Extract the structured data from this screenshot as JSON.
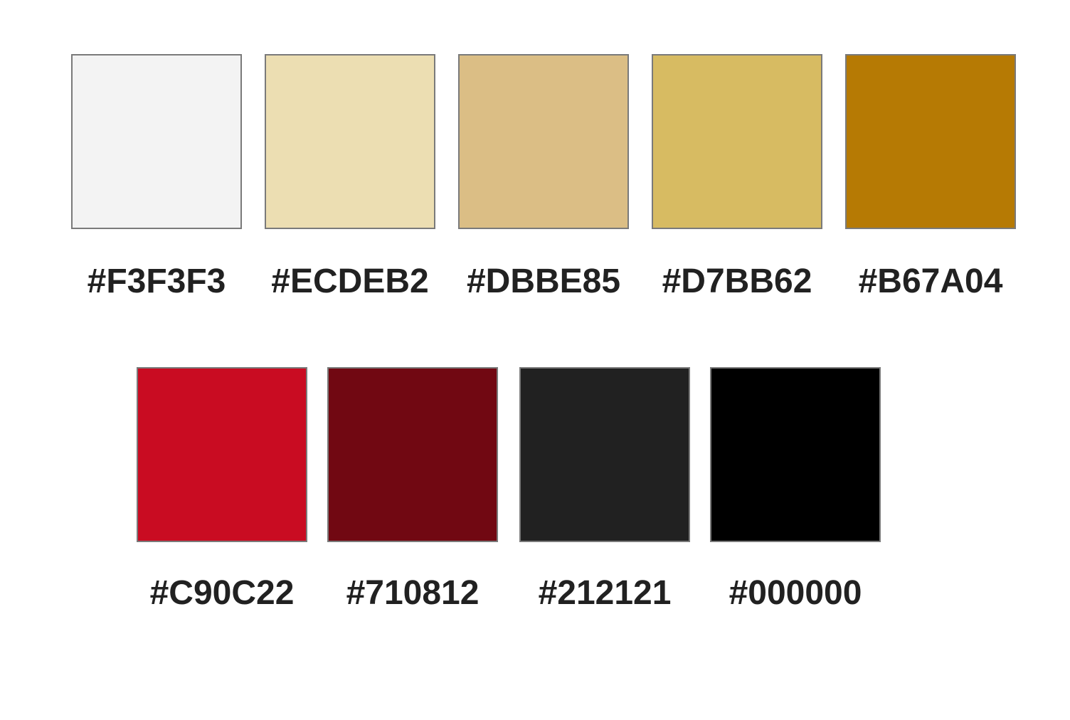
{
  "palette": {
    "swatches": [
      {
        "hex": "#F3F3F3",
        "color": "#F3F3F3"
      },
      {
        "hex": "#ECDEB2",
        "color": "#ECDEB2"
      },
      {
        "hex": "#DBBE85",
        "color": "#DBBE85"
      },
      {
        "hex": "#D7BB62",
        "color": "#D7BB62"
      },
      {
        "hex": "#B67A04",
        "color": "#B67A04"
      },
      {
        "hex": "#C90C22",
        "color": "#C90C22"
      },
      {
        "hex": "#710812",
        "color": "#710812"
      },
      {
        "hex": "#212121",
        "color": "#212121"
      },
      {
        "hex": "#000000",
        "color": "#000000"
      }
    ]
  }
}
